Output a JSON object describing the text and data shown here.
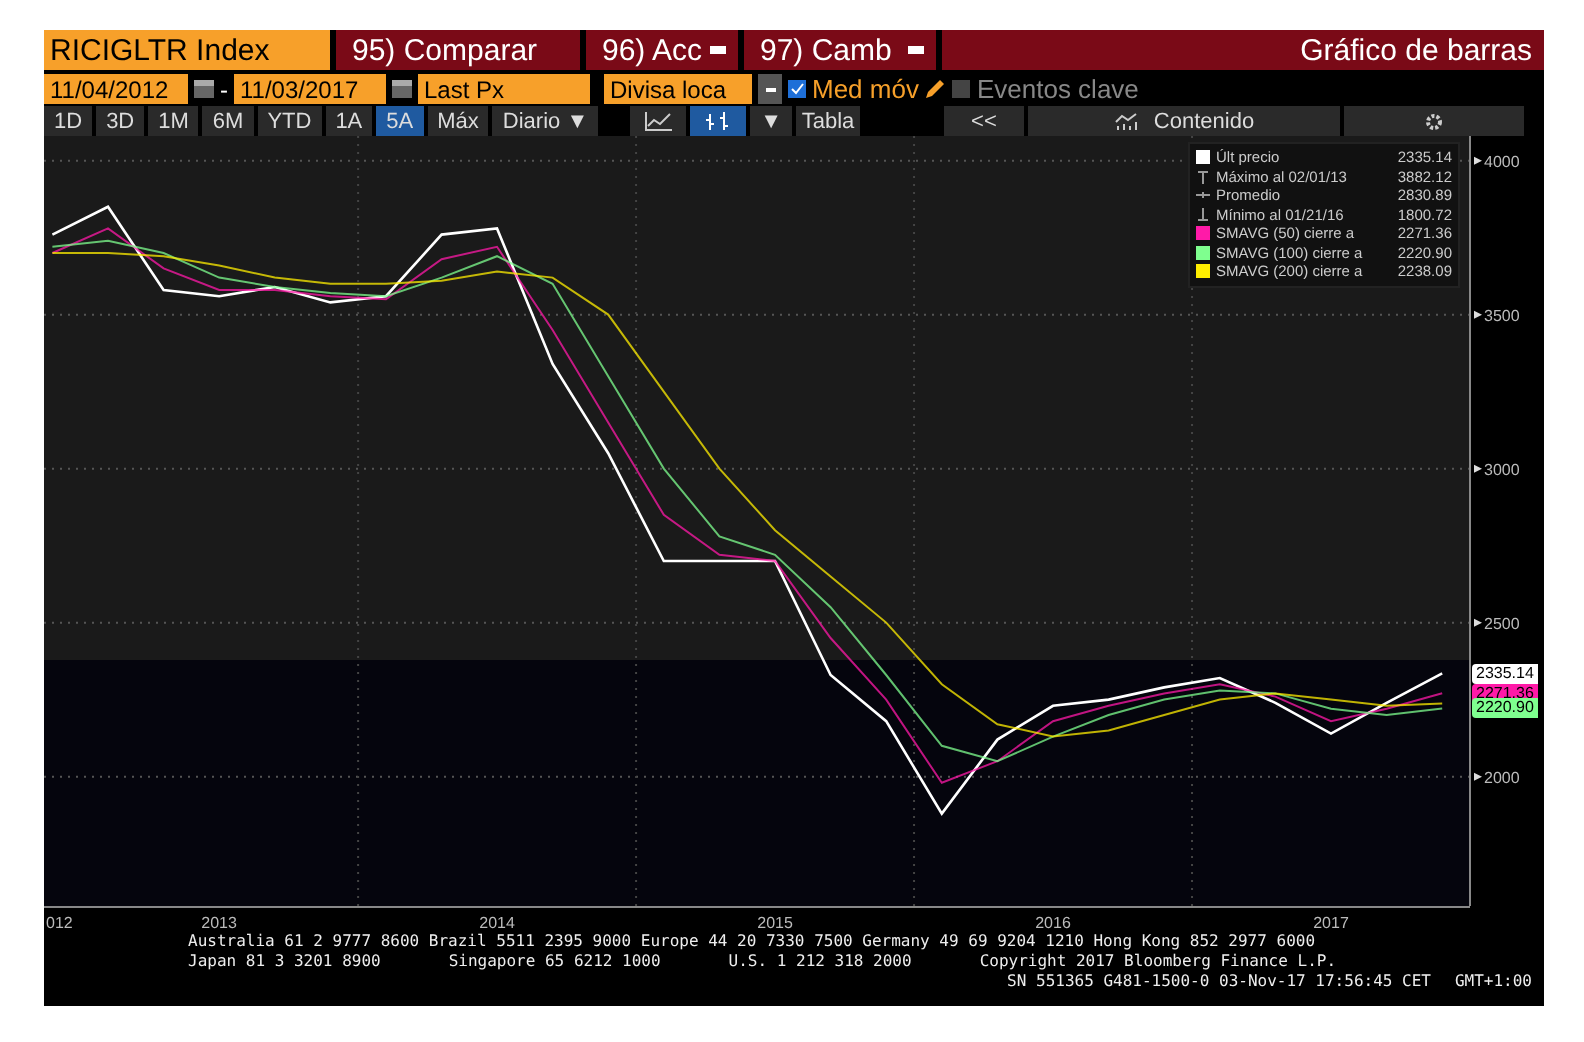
{
  "header": {
    "security": "RICIGLTR Index",
    "actions": [
      {
        "label": "95) Comparar",
        "dropdown": false
      },
      {
        "label": "96) Acc",
        "dropdown": true
      },
      {
        "label": "97) Camb",
        "dropdown": true
      }
    ],
    "title": "Gráfico de barras"
  },
  "settings": {
    "start_date": "11/04/2012",
    "separator": "-",
    "end_date": "11/03/2017",
    "field": "Last Px",
    "currency": "Divisa loca",
    "options": [
      {
        "label": "Med móv",
        "checked": true,
        "editable": true
      },
      {
        "label": "Eventos clave",
        "checked": false,
        "editable": false
      }
    ]
  },
  "periods": [
    {
      "label": "1D",
      "selected": false
    },
    {
      "label": "3D",
      "selected": false
    },
    {
      "label": "1M",
      "selected": false
    },
    {
      "label": "6M",
      "selected": false
    },
    {
      "label": "YTD",
      "selected": false
    },
    {
      "label": "1A",
      "selected": false
    },
    {
      "label": "5A",
      "selected": true
    },
    {
      "label": "Máx",
      "selected": false
    }
  ],
  "toolbar": {
    "frequency": "Diario ▼",
    "chart_types": [
      {
        "kind": "line",
        "selected": false
      },
      {
        "kind": "bars",
        "selected": true
      }
    ],
    "type_menu": "▼",
    "table": "Tabla",
    "collapse": "<<",
    "contents": "Contenido"
  },
  "legend": [
    {
      "kind": "series",
      "value": "2335.14"
    },
    {
      "kind": "max",
      "label": "Máximo al 02/01/13",
      "value": "3882.12"
    },
    {
      "kind": "avg",
      "label": "Promedio",
      "value": "2830.89"
    },
    {
      "kind": "min",
      "label": "Mínimo al 01/21/16",
      "value": "1800.72"
    },
    {
      "kind": "series",
      "value": "2271.36"
    },
    {
      "kind": "series",
      "value": "2220.90"
    },
    {
      "kind": "series",
      "value": "2238.09"
    }
  ],
  "price_tags": [
    {
      "value": "2335.14",
      "color": "#ffffff"
    },
    {
      "value": "2271.36",
      "color": "#ff1aa8"
    },
    {
      "value": "2220.90",
      "color": "#7fff8f"
    }
  ],
  "chart_data": {
    "type": "line",
    "grid": true,
    "x": [
      2012.4,
      2012.6,
      2012.8,
      2013.0,
      2013.2,
      2013.4,
      2013.6,
      2013.8,
      2014.0,
      2014.2,
      2014.4,
      2014.6,
      2014.8,
      2015.0,
      2015.2,
      2015.4,
      2015.6,
      2015.8,
      2016.0,
      2016.2,
      2016.4,
      2016.6,
      2016.8,
      2017.0,
      2017.2,
      2017.4
    ],
    "series": [
      {
        "name": "Últ precio",
        "color": "#ffffff",
        "values": [
          3760,
          3850,
          3580,
          3560,
          3590,
          3540,
          3560,
          3760,
          3780,
          3340,
          3050,
          2700,
          2700,
          2700,
          2330,
          2180,
          1880,
          2120,
          2230,
          2250,
          2290,
          2320,
          2240,
          2140,
          2240,
          2335
        ]
      },
      {
        "name": "SMAVG (50) cierre a",
        "color": "#ff1aa8",
        "values": [
          3700,
          3780,
          3650,
          3580,
          3580,
          3560,
          3550,
          3680,
          3720,
          3450,
          3150,
          2850,
          2720,
          2700,
          2450,
          2250,
          1980,
          2050,
          2180,
          2230,
          2270,
          2300,
          2260,
          2180,
          2220,
          2271
        ]
      },
      {
        "name": "SMAVG (100) cierre a",
        "color": "#7fff8f",
        "values": [
          3720,
          3740,
          3700,
          3620,
          3590,
          3570,
          3560,
          3620,
          3690,
          3600,
          3300,
          3000,
          2780,
          2720,
          2550,
          2330,
          2100,
          2050,
          2130,
          2200,
          2250,
          2280,
          2270,
          2220,
          2200,
          2221
        ]
      },
      {
        "name": "SMAVG (200) cierre a",
        "color": "#ffee00",
        "values": [
          3700,
          3700,
          3690,
          3660,
          3620,
          3600,
          3600,
          3610,
          3640,
          3620,
          3500,
          3250,
          3000,
          2800,
          2650,
          2500,
          2300,
          2170,
          2130,
          2150,
          2200,
          2250,
          2270,
          2250,
          2230,
          2238
        ]
      }
    ],
    "xlim": [
      2012.37,
      2017.5
    ],
    "ylim": [
      1580,
      4080
    ],
    "yticks": [
      2000,
      2500,
      3000,
      3500,
      4000
    ],
    "xticks": [
      2013,
      2014,
      2015,
      2016,
      2017
    ]
  },
  "axis_edge_label": "012",
  "footer": {
    "lines": [
      [
        "Australia 61 2 9777 8600 Brazil 5511 2395 9000 Europe 44 20 7330 7500 Germany 49 69 9204 1210 Hong Kong 852 2977 6000"
      ],
      [
        "Japan 81 3 3201 8900",
        "Singapore 65 6212 1000",
        "U.S. 1 212 318 2000",
        "Copyright 2017 Bloomberg Finance L.P."
      ],
      [
        "SN 551365 G481-1500-0 03-Nov-17 17:56:45 CET",
        "GMT+1:00"
      ]
    ]
  }
}
